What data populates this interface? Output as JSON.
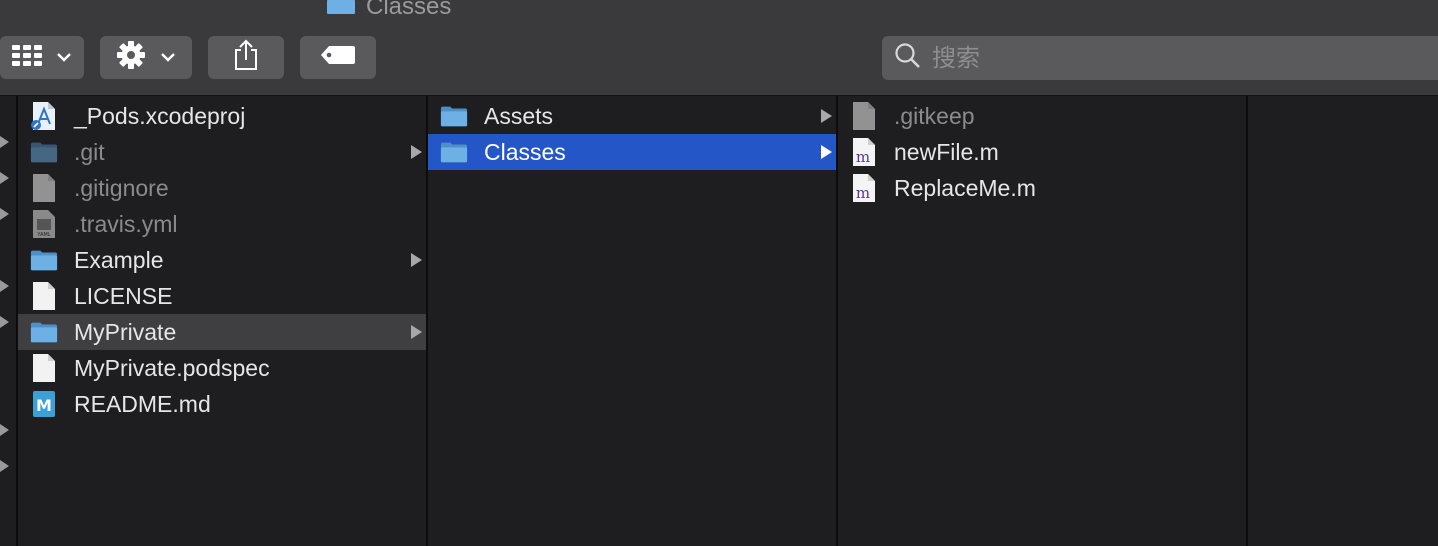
{
  "window": {
    "title": "Classes",
    "title_icon": "folder-icon"
  },
  "toolbar": {
    "view_button_icon": "grid-view-icon",
    "action_button_icon": "gear-icon",
    "share_button_icon": "share-icon",
    "tag_button_icon": "tag-icon",
    "search_placeholder": "搜索"
  },
  "columns": [
    {
      "items": [
        {
          "name": "_Pods.xcodeproj",
          "icon": "xcodeproj-icon",
          "dim": false,
          "has_children": false,
          "selected": ""
        },
        {
          "name": ".git",
          "icon": "folder-icon",
          "dim": true,
          "has_children": true,
          "selected": ""
        },
        {
          "name": ".gitignore",
          "icon": "document-icon",
          "dim": true,
          "has_children": false,
          "selected": ""
        },
        {
          "name": ".travis.yml",
          "icon": "yaml-file-icon",
          "dim": true,
          "has_children": false,
          "selected": ""
        },
        {
          "name": "Example",
          "icon": "folder-icon",
          "dim": false,
          "has_children": true,
          "selected": ""
        },
        {
          "name": "LICENSE",
          "icon": "document-icon",
          "dim": false,
          "has_children": false,
          "selected": ""
        },
        {
          "name": "MyPrivate",
          "icon": "folder-icon",
          "dim": false,
          "has_children": true,
          "selected": "inactive"
        },
        {
          "name": "MyPrivate.podspec",
          "icon": "document-icon",
          "dim": false,
          "has_children": false,
          "selected": ""
        },
        {
          "name": "README.md",
          "icon": "markdown-file-icon",
          "dim": false,
          "has_children": false,
          "selected": ""
        }
      ]
    },
    {
      "items": [
        {
          "name": "Assets",
          "icon": "folder-icon",
          "dim": false,
          "has_children": true,
          "selected": ""
        },
        {
          "name": "Classes",
          "icon": "folder-icon",
          "dim": false,
          "has_children": true,
          "selected": "active"
        }
      ]
    },
    {
      "items": [
        {
          "name": ".gitkeep",
          "icon": "document-icon",
          "dim": true,
          "has_children": false,
          "selected": ""
        },
        {
          "name": "newFile.m",
          "icon": "objc-source-icon",
          "dim": false,
          "has_children": false,
          "selected": ""
        },
        {
          "name": "ReplaceMe.m",
          "icon": "objc-source-icon",
          "dim": false,
          "has_children": false,
          "selected": ""
        }
      ]
    },
    {
      "items": []
    }
  ],
  "colors": {
    "selection_active": "#2556c8",
    "selection_inactive": "#3f3f42",
    "folder": "#5fa3d8"
  }
}
